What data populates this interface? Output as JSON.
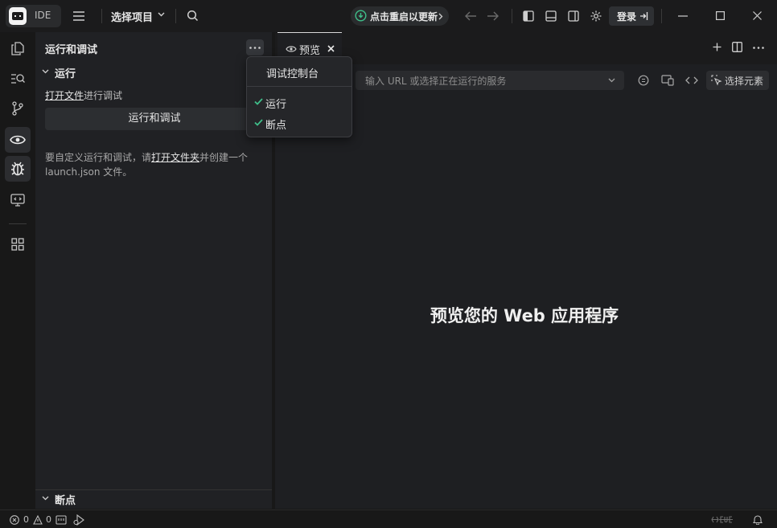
{
  "titlebar": {
    "logo_text": "IDE",
    "project_label": "选择项目",
    "update_label": "点击重启以更新",
    "login_label": "登录"
  },
  "sidebar": {
    "title": "运行和调试",
    "run_section": "运行",
    "open_file_link": "打开文件",
    "open_file_suffix": "进行调试",
    "run_debug_button": "运行和调试",
    "hint_prefix": "要自定义运行和调试，请",
    "hint_link": "打开文件夹",
    "hint_suffix": "并创建一个 launch.json 文件。",
    "breakpoints_section": "断点"
  },
  "menu": {
    "items": [
      "调试控制台",
      "运行",
      "断点"
    ]
  },
  "editor": {
    "tab_label": "预览",
    "url_placeholder": "输入 URL 或选择正在运行的服务",
    "select_element_label": "选择元素",
    "hero_text": "预览您的 Web 应用程序"
  },
  "status": {
    "errors": "0",
    "warnings": "0"
  },
  "colors": {
    "accent_green": "#3fbf8a",
    "background": "#181818"
  }
}
